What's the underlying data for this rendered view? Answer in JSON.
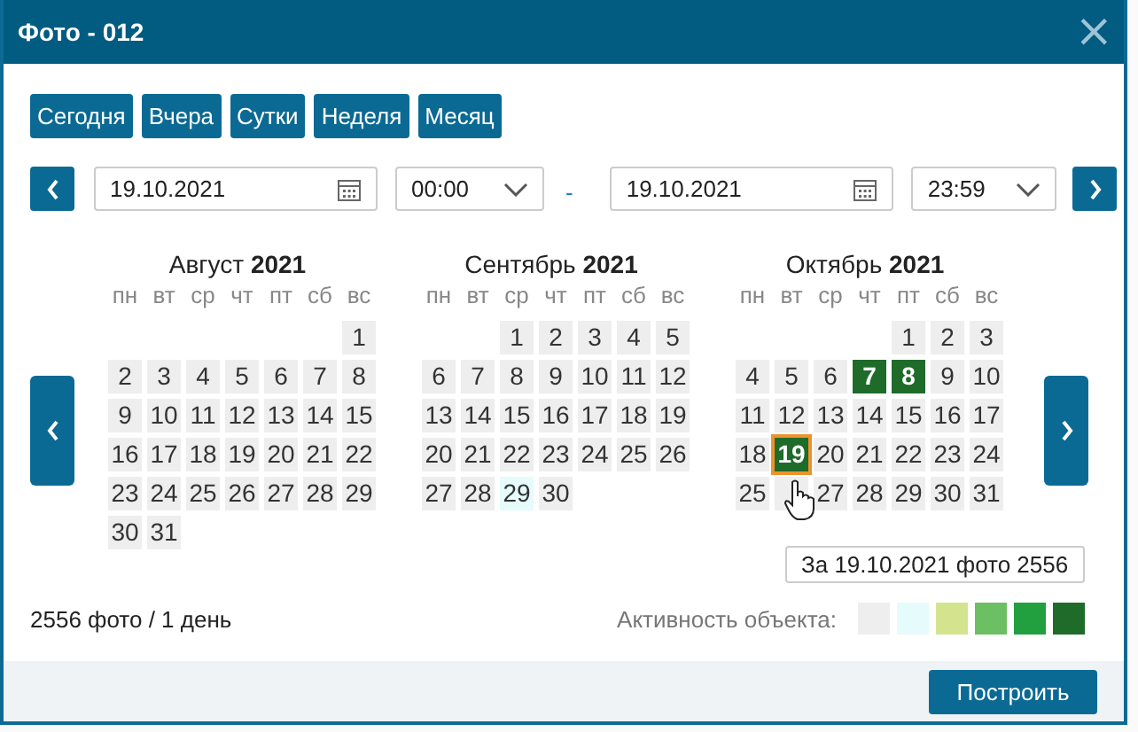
{
  "window": {
    "title": "Фото - 012",
    "close": "×"
  },
  "quick_ranges": [
    "Сегодня",
    "Вчера",
    "Сутки",
    "Неделя",
    "Месяц"
  ],
  "range": {
    "from_date": "19.10.2021",
    "from_time": "00:00",
    "separator": "-",
    "to_date": "19.10.2021",
    "to_time": "23:59"
  },
  "months": [
    {
      "name": "Август",
      "year": "2021",
      "weekdays": [
        "пн",
        "вт",
        "ср",
        "чт",
        "пт",
        "сб",
        "вс"
      ],
      "weeks": [
        [
          {
            "kind": "blank"
          },
          {
            "kind": "blank"
          },
          {
            "kind": "blank"
          },
          {
            "kind": "blank"
          },
          {
            "kind": "blank"
          },
          {
            "kind": "blank"
          },
          {
            "kind": "day",
            "d": "1",
            "color": "#eeeeee",
            "selected": false
          }
        ],
        [
          {
            "kind": "day",
            "d": "2",
            "color": "#eeeeee",
            "selected": false
          },
          {
            "kind": "day",
            "d": "3",
            "color": "#eeeeee",
            "selected": false
          },
          {
            "kind": "day",
            "d": "4",
            "color": "#eeeeee",
            "selected": false
          },
          {
            "kind": "day",
            "d": "5",
            "color": "#eeeeee",
            "selected": false
          },
          {
            "kind": "day",
            "d": "6",
            "color": "#eeeeee",
            "selected": false
          },
          {
            "kind": "day",
            "d": "7",
            "color": "#eeeeee",
            "selected": false
          },
          {
            "kind": "day",
            "d": "8",
            "color": "#eeeeee",
            "selected": false
          }
        ],
        [
          {
            "kind": "day",
            "d": "9",
            "color": "#eeeeee",
            "selected": false
          },
          {
            "kind": "day",
            "d": "10",
            "color": "#eeeeee",
            "selected": false
          },
          {
            "kind": "day",
            "d": "11",
            "color": "#eeeeee",
            "selected": false
          },
          {
            "kind": "day",
            "d": "12",
            "color": "#eeeeee",
            "selected": false
          },
          {
            "kind": "day",
            "d": "13",
            "color": "#eeeeee",
            "selected": false
          },
          {
            "kind": "day",
            "d": "14",
            "color": "#eeeeee",
            "selected": false
          },
          {
            "kind": "day",
            "d": "15",
            "color": "#eeeeee",
            "selected": false
          }
        ],
        [
          {
            "kind": "day",
            "d": "16",
            "color": "#eeeeee",
            "selected": false
          },
          {
            "kind": "day",
            "d": "17",
            "color": "#eeeeee",
            "selected": false
          },
          {
            "kind": "day",
            "d": "18",
            "color": "#eeeeee",
            "selected": false
          },
          {
            "kind": "day",
            "d": "19",
            "color": "#eeeeee",
            "selected": false
          },
          {
            "kind": "day",
            "d": "20",
            "color": "#eeeeee",
            "selected": false
          },
          {
            "kind": "day",
            "d": "21",
            "color": "#eeeeee",
            "selected": false
          },
          {
            "kind": "day",
            "d": "22",
            "color": "#eeeeee",
            "selected": false
          }
        ],
        [
          {
            "kind": "day",
            "d": "23",
            "color": "#eeeeee",
            "selected": false
          },
          {
            "kind": "day",
            "d": "24",
            "color": "#eeeeee",
            "selected": false
          },
          {
            "kind": "day",
            "d": "25",
            "color": "#eeeeee",
            "selected": false
          },
          {
            "kind": "day",
            "d": "26",
            "color": "#eeeeee",
            "selected": false
          },
          {
            "kind": "day",
            "d": "27",
            "color": "#eeeeee",
            "selected": false
          },
          {
            "kind": "day",
            "d": "28",
            "color": "#eeeeee",
            "selected": false
          },
          {
            "kind": "day",
            "d": "29",
            "color": "#eeeeee",
            "selected": false
          }
        ],
        [
          {
            "kind": "day",
            "d": "30",
            "color": "#eeeeee",
            "selected": false
          },
          {
            "kind": "day",
            "d": "31",
            "color": "#eeeeee",
            "selected": false
          }
        ]
      ]
    },
    {
      "name": "Сентябрь",
      "year": "2021",
      "weekdays": [
        "пн",
        "вт",
        "ср",
        "чт",
        "пт",
        "сб",
        "вс"
      ],
      "weeks": [
        [
          {
            "kind": "blank"
          },
          {
            "kind": "blank"
          },
          {
            "kind": "day",
            "d": "1",
            "color": "#eeeeee",
            "selected": false
          },
          {
            "kind": "day",
            "d": "2",
            "color": "#eeeeee",
            "selected": false
          },
          {
            "kind": "day",
            "d": "3",
            "color": "#eeeeee",
            "selected": false
          },
          {
            "kind": "day",
            "d": "4",
            "color": "#eeeeee",
            "selected": false
          },
          {
            "kind": "day",
            "d": "5",
            "color": "#eeeeee",
            "selected": false
          }
        ],
        [
          {
            "kind": "day",
            "d": "6",
            "color": "#eeeeee",
            "selected": false
          },
          {
            "kind": "day",
            "d": "7",
            "color": "#eeeeee",
            "selected": false
          },
          {
            "kind": "day",
            "d": "8",
            "color": "#eeeeee",
            "selected": false
          },
          {
            "kind": "day",
            "d": "9",
            "color": "#eeeeee",
            "selected": false
          },
          {
            "kind": "day",
            "d": "10",
            "color": "#eeeeee",
            "selected": false
          },
          {
            "kind": "day",
            "d": "11",
            "color": "#eeeeee",
            "selected": false
          },
          {
            "kind": "day",
            "d": "12",
            "color": "#eeeeee",
            "selected": false
          }
        ],
        [
          {
            "kind": "day",
            "d": "13",
            "color": "#eeeeee",
            "selected": false
          },
          {
            "kind": "day",
            "d": "14",
            "color": "#eeeeee",
            "selected": false
          },
          {
            "kind": "day",
            "d": "15",
            "color": "#eeeeee",
            "selected": false
          },
          {
            "kind": "day",
            "d": "16",
            "color": "#eeeeee",
            "selected": false
          },
          {
            "kind": "day",
            "d": "17",
            "color": "#eeeeee",
            "selected": false
          },
          {
            "kind": "day",
            "d": "18",
            "color": "#eeeeee",
            "selected": false
          },
          {
            "kind": "day",
            "d": "19",
            "color": "#eeeeee",
            "selected": false
          }
        ],
        [
          {
            "kind": "day",
            "d": "20",
            "color": "#eeeeee",
            "selected": false
          },
          {
            "kind": "day",
            "d": "21",
            "color": "#eeeeee",
            "selected": false
          },
          {
            "kind": "day",
            "d": "22",
            "color": "#eeeeee",
            "selected": false
          },
          {
            "kind": "day",
            "d": "23",
            "color": "#eeeeee",
            "selected": false
          },
          {
            "kind": "day",
            "d": "24",
            "color": "#eeeeee",
            "selected": false
          },
          {
            "kind": "day",
            "d": "25",
            "color": "#eeeeee",
            "selected": false
          },
          {
            "kind": "day",
            "d": "26",
            "color": "#eeeeee",
            "selected": false
          }
        ],
        [
          {
            "kind": "day",
            "d": "27",
            "color": "#eeeeee",
            "selected": false
          },
          {
            "kind": "day",
            "d": "28",
            "color": "#eeeeee",
            "selected": false
          },
          {
            "kind": "day",
            "d": "29",
            "color": "#e6fbfb",
            "selected": false
          },
          {
            "kind": "day",
            "d": "30",
            "color": "#eeeeee",
            "selected": false
          }
        ]
      ]
    },
    {
      "name": "Октябрь",
      "year": "2021",
      "weekdays": [
        "пн",
        "вт",
        "ср",
        "чт",
        "пт",
        "сб",
        "вс"
      ],
      "weeks": [
        [
          {
            "kind": "blank"
          },
          {
            "kind": "blank"
          },
          {
            "kind": "blank"
          },
          {
            "kind": "blank"
          },
          {
            "kind": "day",
            "d": "1",
            "color": "#eeeeee",
            "selected": false
          },
          {
            "kind": "day",
            "d": "2",
            "color": "#eeeeee",
            "selected": false
          },
          {
            "kind": "day",
            "d": "3",
            "color": "#eeeeee",
            "selected": false
          }
        ],
        [
          {
            "kind": "day",
            "d": "4",
            "color": "#eeeeee",
            "selected": false
          },
          {
            "kind": "day",
            "d": "5",
            "color": "#eeeeee",
            "selected": false
          },
          {
            "kind": "day",
            "d": "6",
            "color": "#eeeeee",
            "selected": false
          },
          {
            "kind": "day",
            "d": "7",
            "color": "#1e6b2a",
            "selected": false
          },
          {
            "kind": "day",
            "d": "8",
            "color": "#1e6b2a",
            "selected": false
          },
          {
            "kind": "day",
            "d": "9",
            "color": "#eeeeee",
            "selected": false
          },
          {
            "kind": "day",
            "d": "10",
            "color": "#eeeeee",
            "selected": false
          }
        ],
        [
          {
            "kind": "day",
            "d": "11",
            "color": "#eeeeee",
            "selected": false
          },
          {
            "kind": "day",
            "d": "12",
            "color": "#eeeeee",
            "selected": false
          },
          {
            "kind": "day",
            "d": "13",
            "color": "#eeeeee",
            "selected": false
          },
          {
            "kind": "day",
            "d": "14",
            "color": "#eeeeee",
            "selected": false
          },
          {
            "kind": "day",
            "d": "15",
            "color": "#eeeeee",
            "selected": false
          },
          {
            "kind": "day",
            "d": "16",
            "color": "#eeeeee",
            "selected": false
          },
          {
            "kind": "day",
            "d": "17",
            "color": "#eeeeee",
            "selected": false
          }
        ],
        [
          {
            "kind": "day",
            "d": "18",
            "color": "#eeeeee",
            "selected": false
          },
          {
            "kind": "day",
            "d": "19",
            "color": "#1e6b2a",
            "selected": true
          },
          {
            "kind": "day",
            "d": "20",
            "color": "#eeeeee",
            "selected": false
          },
          {
            "kind": "day",
            "d": "21",
            "color": "#eeeeee",
            "selected": false
          },
          {
            "kind": "day",
            "d": "22",
            "color": "#eeeeee",
            "selected": false
          },
          {
            "kind": "day",
            "d": "23",
            "color": "#eeeeee",
            "selected": false
          },
          {
            "kind": "day",
            "d": "24",
            "color": "#eeeeee",
            "selected": false
          }
        ],
        [
          {
            "kind": "day",
            "d": "25",
            "color": "#eeeeee",
            "selected": false
          },
          {
            "kind": "covered",
            "color": "#eeeeee"
          },
          {
            "kind": "day",
            "d": "27",
            "color": "#eeeeee",
            "selected": false
          },
          {
            "kind": "day",
            "d": "28",
            "color": "#eeeeee",
            "selected": false
          },
          {
            "kind": "day",
            "d": "29",
            "color": "#eeeeee",
            "selected": false
          },
          {
            "kind": "day",
            "d": "30",
            "color": "#eeeeee",
            "selected": false
          },
          {
            "kind": "day",
            "d": "31",
            "color": "#eeeeee",
            "selected": false
          }
        ]
      ]
    }
  ],
  "tooltip": "За 19.10.2021 фото 2556",
  "summary": "2556 фото / 1 день",
  "legend": {
    "label": "Активность объекта:",
    "swatches": [
      {
        "color": "#eeeeee"
      },
      {
        "color": "#e6fbfb"
      },
      {
        "color": "#d4e48e"
      },
      {
        "color": "#6cbf62"
      },
      {
        "color": "#22a040"
      },
      {
        "color": "#1e6b2a"
      }
    ]
  },
  "build_button": "Построить"
}
